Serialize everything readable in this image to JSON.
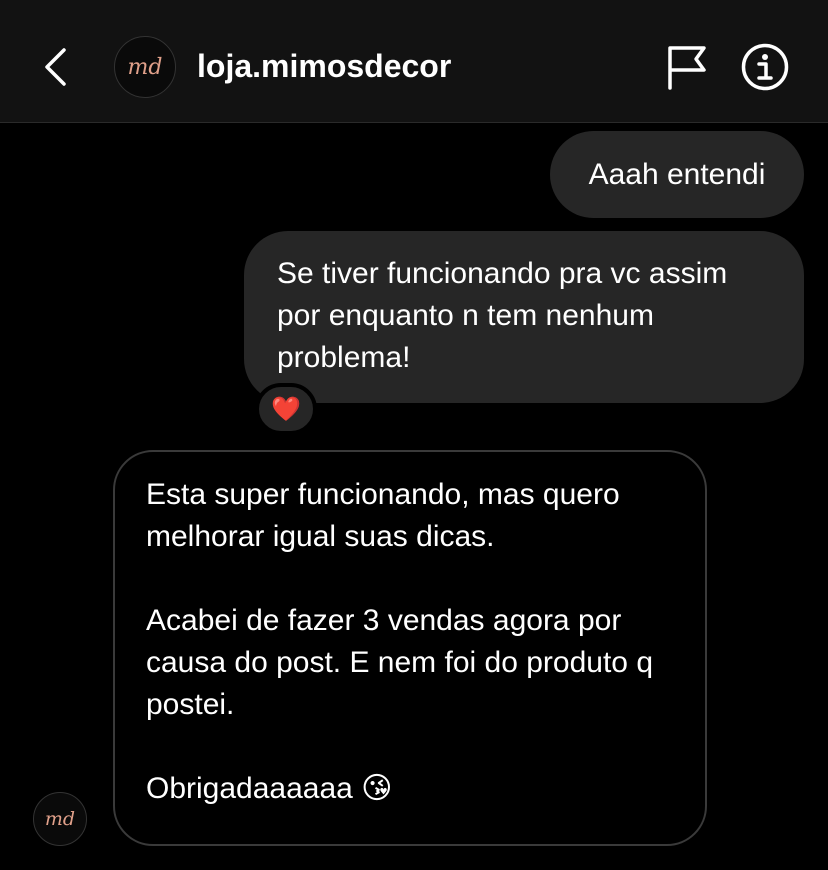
{
  "header": {
    "title": "loja.mimosdecor",
    "avatar_text": "md",
    "icons": [
      "back-chevron-icon",
      "flag-icon",
      "info-icon"
    ]
  },
  "messages": [
    {
      "from": "me",
      "lines": [
        "Aaah entendi"
      ]
    },
    {
      "from": "me",
      "lines": [
        "Se tiver funcionando pra vc assim",
        "por enquanto n tem nenhum",
        "problema!"
      ],
      "reaction": "❤️"
    },
    {
      "from": "them",
      "paragraphs": [
        "Esta super funcionando, mas quero melhorar igual suas dicas.",
        "Acabei de fazer 3 vendas agora por causa do post. E nem foi do produto q postei.",
        "Obrigadaaaaaa 😘"
      ]
    }
  ],
  "colors": {
    "background": "#000000",
    "header": "#121212",
    "bubble": "#262626",
    "accent": "#e0a08a"
  }
}
